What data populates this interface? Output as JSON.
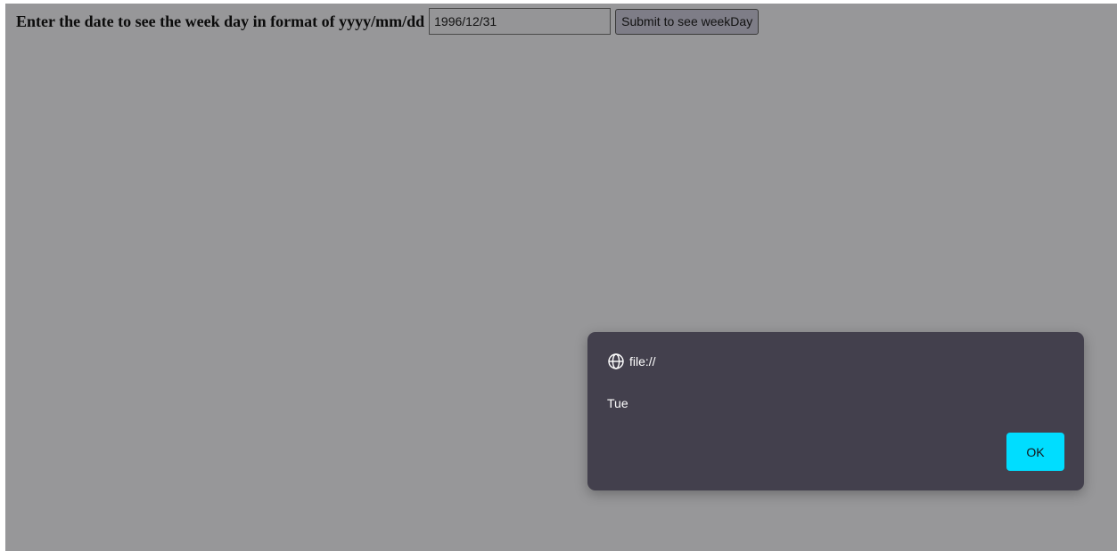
{
  "form": {
    "prompt_text": "Enter the date to see the week day in format of yyyy/mm/dd",
    "date_value": "1996/12/31",
    "submit_label": "Submit to see weekDay"
  },
  "alert": {
    "origin": "file://",
    "origin_icon": "globe-icon",
    "message": "Tue",
    "ok_label": "OK",
    "accent_color": "#00ddff"
  }
}
